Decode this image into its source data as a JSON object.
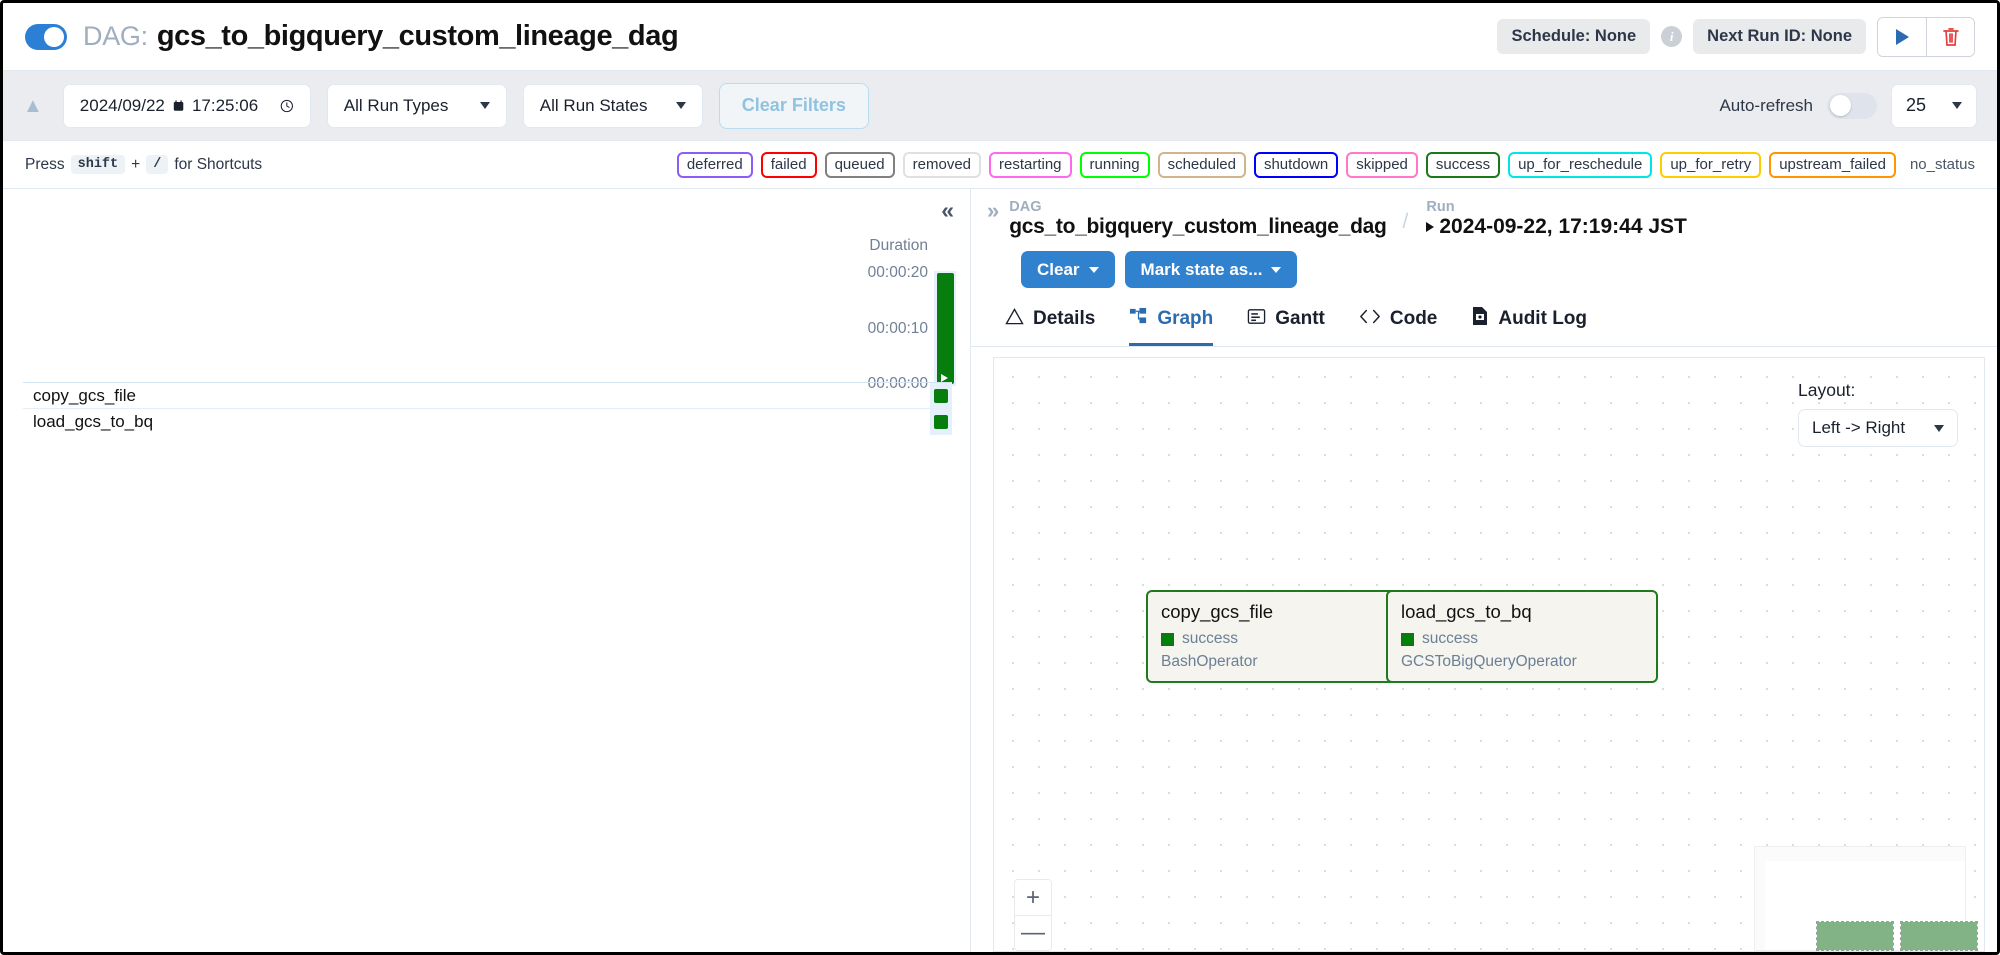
{
  "header": {
    "toggle_on": true,
    "dag_prefix": "DAG:",
    "dag_name": "gcs_to_bigquery_custom_lineage_dag",
    "schedule_chip": "Schedule: None",
    "info_icon": "i",
    "next_run_chip": "Next Run ID: None",
    "trigger_icon": "play-icon",
    "delete_icon": "trash-icon"
  },
  "filters": {
    "collapse_icon": "chevron-up-icon",
    "date_value": "2024/09/22",
    "calendar_icon": "calendar-icon",
    "time_value": "17:25:06",
    "clock_icon": "clock-icon",
    "run_types": "All Run Types",
    "run_states": "All Run States",
    "clear_filters": "Clear Filters",
    "auto_refresh_label": "Auto-refresh",
    "auto_refresh_on": false,
    "num_runs": "25"
  },
  "legend": {
    "press": "Press",
    "key1": "shift",
    "plus": "+",
    "key2": "/",
    "for_shortcuts": "for Shortcuts",
    "states": [
      {
        "label": "deferred",
        "color": "#8b5cf6"
      },
      {
        "label": "failed",
        "color": "#ff0000"
      },
      {
        "label": "queued",
        "color": "#808080"
      },
      {
        "label": "removed",
        "color": "#e0e0e0"
      },
      {
        "label": "restarting",
        "color": "#ff69f0"
      },
      {
        "label": "running",
        "color": "#00ff00"
      },
      {
        "label": "scheduled",
        "color": "#d2b48c"
      },
      {
        "label": "shutdown",
        "color": "#0000ff"
      },
      {
        "label": "skipped",
        "color": "#ff77c8"
      },
      {
        "label": "success",
        "color": "#1a7a1a"
      },
      {
        "label": "up_for_reschedule",
        "color": "#00e5e5"
      },
      {
        "label": "up_for_retry",
        "color": "#ffcc00"
      },
      {
        "label": "upstream_failed",
        "color": "#ff9500"
      }
    ],
    "no_status": "no_status"
  },
  "grid": {
    "collapse_icon": "chevrons-left-icon",
    "duration_title": "Duration",
    "axis_labels": [
      "00:00:20",
      "00:00:10",
      "00:00:00"
    ],
    "tasks": [
      {
        "name": "copy_gcs_file",
        "state": "success"
      },
      {
        "name": "load_gcs_to_bq",
        "state": "success"
      }
    ]
  },
  "detail": {
    "expand_icon": "chevrons-right-icon",
    "dag_caption": "DAG",
    "dag_value": "gcs_to_bigquery_custom_lineage_dag",
    "separator": "/",
    "run_caption": "Run",
    "run_value": "2024-09-22, 17:19:44 JST",
    "clear_btn": "Clear",
    "mark_state_btn": "Mark state as...",
    "tabs": [
      {
        "label": "Details",
        "icon": "triangle-alert-icon",
        "active": false
      },
      {
        "label": "Graph",
        "icon": "graph-icon",
        "active": true
      },
      {
        "label": "Gantt",
        "icon": "gantt-icon",
        "active": false
      },
      {
        "label": "Code",
        "icon": "code-icon",
        "active": false
      },
      {
        "label": "Audit Log",
        "icon": "document-icon",
        "active": false
      }
    ]
  },
  "graph": {
    "layout_label": "Layout:",
    "layout_value": "Left -> Right",
    "zoom_in": "+",
    "zoom_out": "—",
    "nodes": [
      {
        "title": "copy_gcs_file",
        "state": "success",
        "operator": "BashOperator"
      },
      {
        "title": "load_gcs_to_bq",
        "state": "success",
        "operator": "GCSToBigQueryOperator"
      }
    ]
  },
  "colors": {
    "accent": "#3182ce",
    "success": "#067d0d",
    "node_border": "#1f7a1f",
    "node_bg": "#f5f4ee"
  }
}
